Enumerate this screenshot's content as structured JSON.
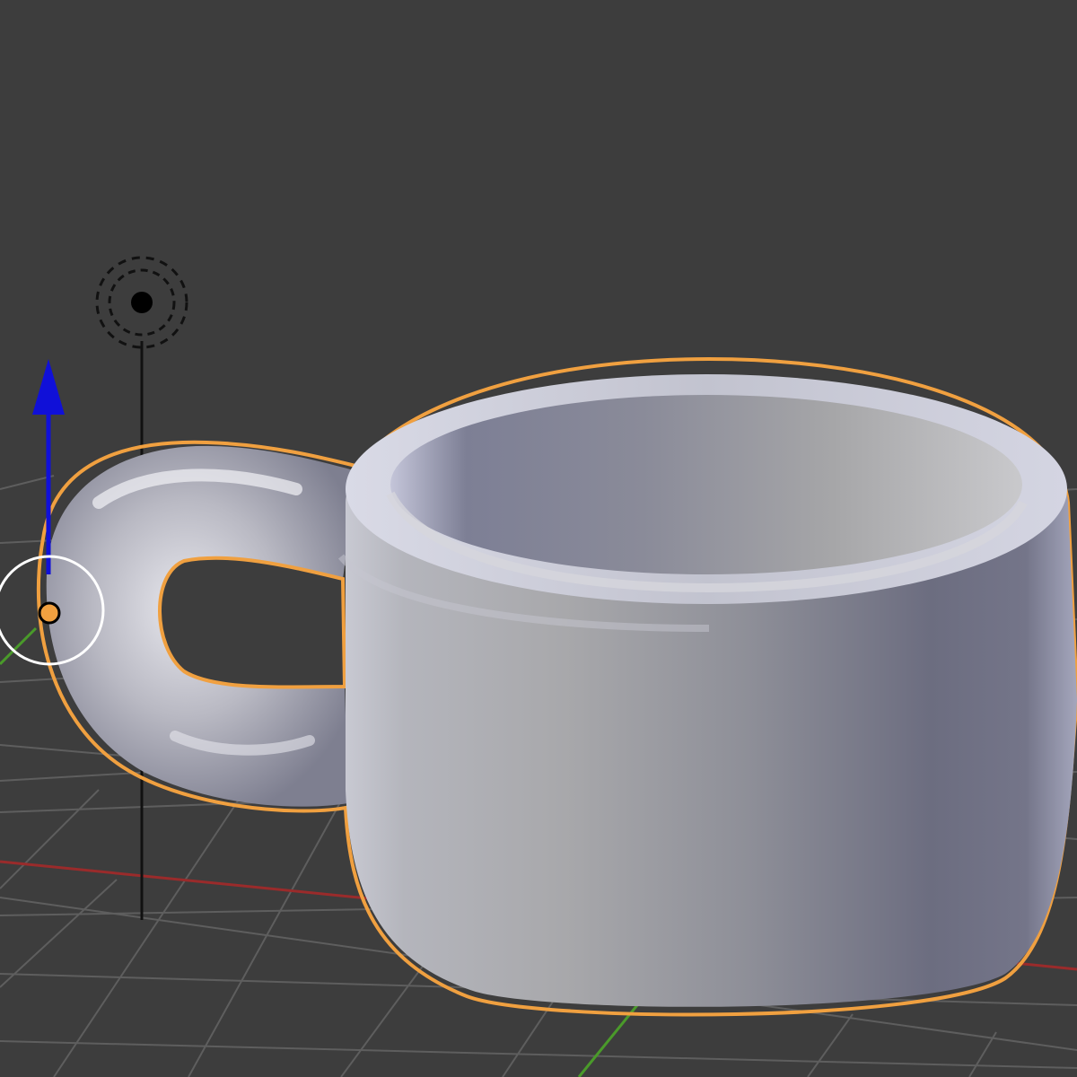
{
  "viewport": {
    "background_color": "#3d3d3d",
    "grid_color": "#5c5c5c",
    "x_axis_color": "#9a2b2b",
    "y_axis_color": "#4a9a2a",
    "selection_outline_color": "#f0a040",
    "gizmo_z_color": "#1010d8"
  },
  "scene": {
    "selected_object": "mug",
    "objects": [
      {
        "name": "lamp",
        "icon": "lamp-icon"
      },
      {
        "name": "mug",
        "icon": "mesh-mug"
      }
    ],
    "transform_manipulator": {
      "axis": "z",
      "icon": "arrow-up-icon"
    },
    "origin_icon": "object-origin-icon"
  }
}
